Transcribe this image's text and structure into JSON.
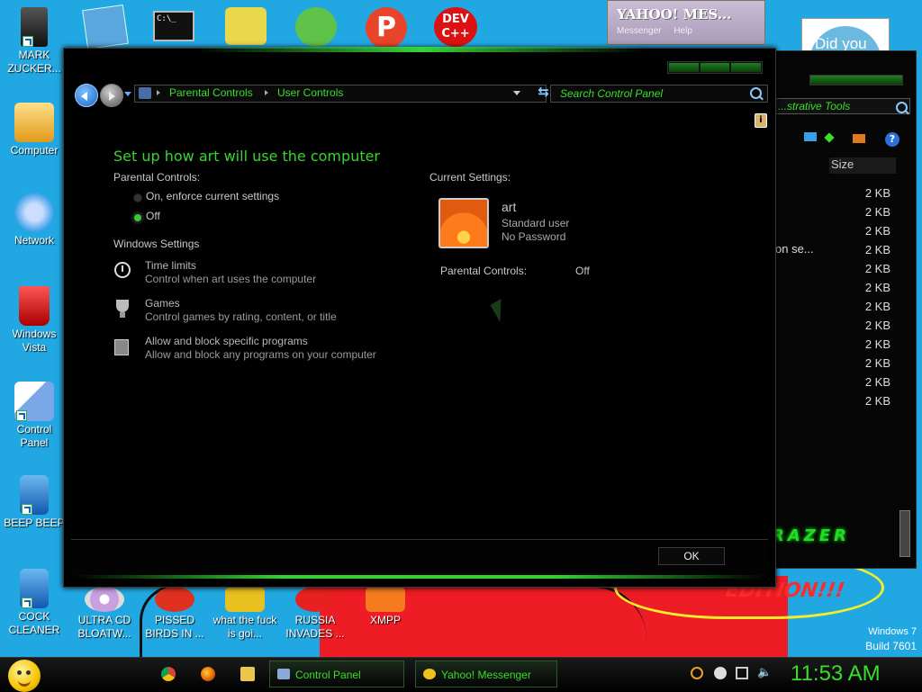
{
  "desktop": {
    "icons": [
      {
        "label": "MARK ZUCKER..."
      },
      {
        "label": "Computer"
      },
      {
        "label": "Network"
      },
      {
        "label": "Windows Vista"
      },
      {
        "label": "Control Panel"
      },
      {
        "label": "BEEP BEEP"
      },
      {
        "label": "COCK CLEANER"
      },
      {
        "label": "ULTRA CD BLOATW..."
      },
      {
        "label": "PISSED BIRDS IN ..."
      },
      {
        "label": "what the fuck is goi..."
      },
      {
        "label": "RUSSIA INVADES ..."
      },
      {
        "label": "XMPP"
      }
    ],
    "top_icons": [
      "cmd-icon",
      "notepad-icon",
      "folder-icon",
      "game-icon",
      "p-icon",
      "devcpp-icon"
    ],
    "devcpp_text": "DEV C++",
    "p_text": "P",
    "wallpaper_text": "EDITION!!!",
    "watermark": {
      "line1": "Windows 7",
      "line2": "Build 7601"
    }
  },
  "yahoo_window": {
    "title": "YAHOO! MES...",
    "menu": [
      "Messenger",
      "Help"
    ]
  },
  "popup": {
    "text": "Did you"
  },
  "back_window": {
    "address": "...strative Tools",
    "column": "Size",
    "left_text": "on se...",
    "sizes": [
      "2 KB",
      "2 KB",
      "2 KB",
      "2 KB",
      "2 KB",
      "2 KB",
      "2 KB",
      "2 KB",
      "2 KB",
      "2 KB",
      "2 KB",
      "2 KB"
    ],
    "brand": "RAZER"
  },
  "window": {
    "breadcrumb": [
      "Parental Controls",
      "User Controls"
    ],
    "search_placeholder": "Search Control Panel",
    "heading": "Set up how art will use the computer",
    "parental_controls_label": "Parental Controls:",
    "options": [
      {
        "label": "On, enforce current settings",
        "selected": false
      },
      {
        "label": "Off",
        "selected": true
      }
    ],
    "windows_settings_label": "Windows Settings",
    "settings": [
      {
        "title": "Time limits",
        "desc": "Control when art uses the computer",
        "icon": "clock-icon"
      },
      {
        "title": "Games",
        "desc": "Control games by rating, content, or title",
        "icon": "trophy-icon"
      },
      {
        "title": "Allow and block specific programs",
        "desc": "Allow and block any programs on your computer",
        "icon": "program-icon"
      }
    ],
    "current_settings_label": "Current Settings:",
    "user": {
      "name": "art",
      "type": "Standard user",
      "password": "No Password"
    },
    "pc_status_label": "Parental Controls:",
    "pc_status_value": "Off",
    "ok_label": "OK"
  },
  "taskbar": {
    "pinned": [
      "chrome-icon",
      "firefox-icon",
      "explorer-icon"
    ],
    "buttons": [
      "Control Panel",
      "Yahoo! Messenger"
    ],
    "clock": "11:53 AM"
  }
}
